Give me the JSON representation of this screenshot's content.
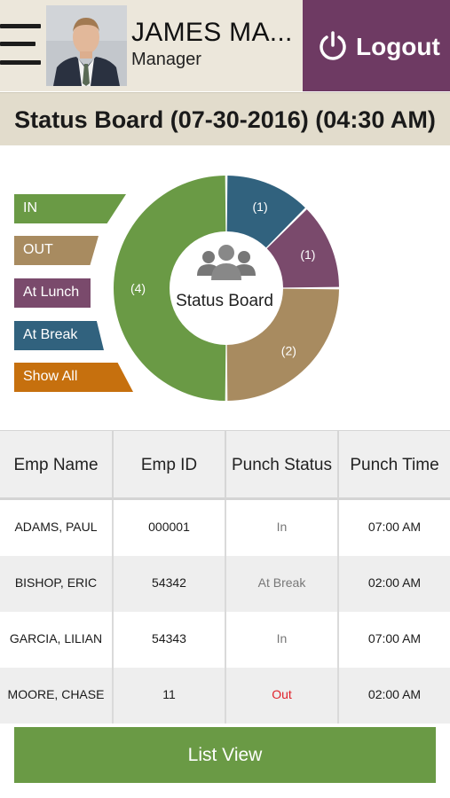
{
  "header": {
    "user_name": "JAMES MA...",
    "user_role": "Manager",
    "logout_label": "Logout"
  },
  "page": {
    "title": "Status Board (07-30-2016) (04:30 AM)"
  },
  "filters": [
    {
      "label": "IN",
      "color": "#6a9a45"
    },
    {
      "label": "OUT",
      "color": "#a88b60"
    },
    {
      "label": "At Lunch",
      "color": "#7a4a6c"
    },
    {
      "label": "At Break",
      "color": "#31627e"
    },
    {
      "label": "Show All",
      "color": "#c6700e"
    }
  ],
  "chart_data": {
    "type": "pie",
    "title": "Status Board",
    "segments": [
      {
        "label": "At Break",
        "value": 1,
        "display": "(1)",
        "color": "#31627e"
      },
      {
        "label": "At Lunch",
        "value": 1,
        "display": "(1)",
        "color": "#7a4a6c"
      },
      {
        "label": "OUT",
        "value": 2,
        "display": "(2)",
        "color": "#a88b60"
      },
      {
        "label": "IN",
        "value": 4,
        "display": "(4)",
        "color": "#6a9a45"
      }
    ]
  },
  "table": {
    "columns": [
      "Emp Name",
      "Emp ID",
      "Punch Status",
      "Punch Time"
    ],
    "rows": [
      {
        "name": "ADAMS, PAUL",
        "id": "000001",
        "status": "In",
        "time": "07:00 AM",
        "status_color": "#777777"
      },
      {
        "name": "BISHOP, ERIC",
        "id": "54342",
        "status": "At Break",
        "time": "02:00 AM",
        "status_color": "#777777"
      },
      {
        "name": "GARCIA, LILIAN",
        "id": "54343",
        "status": "In",
        "time": "07:00 AM",
        "status_color": "#777777"
      },
      {
        "name": "MOORE, CHASE",
        "id": "11",
        "status": "Out",
        "time": "02:00 AM",
        "status_color": "#e0212a"
      }
    ]
  },
  "footer": {
    "list_view_label": "List View"
  }
}
